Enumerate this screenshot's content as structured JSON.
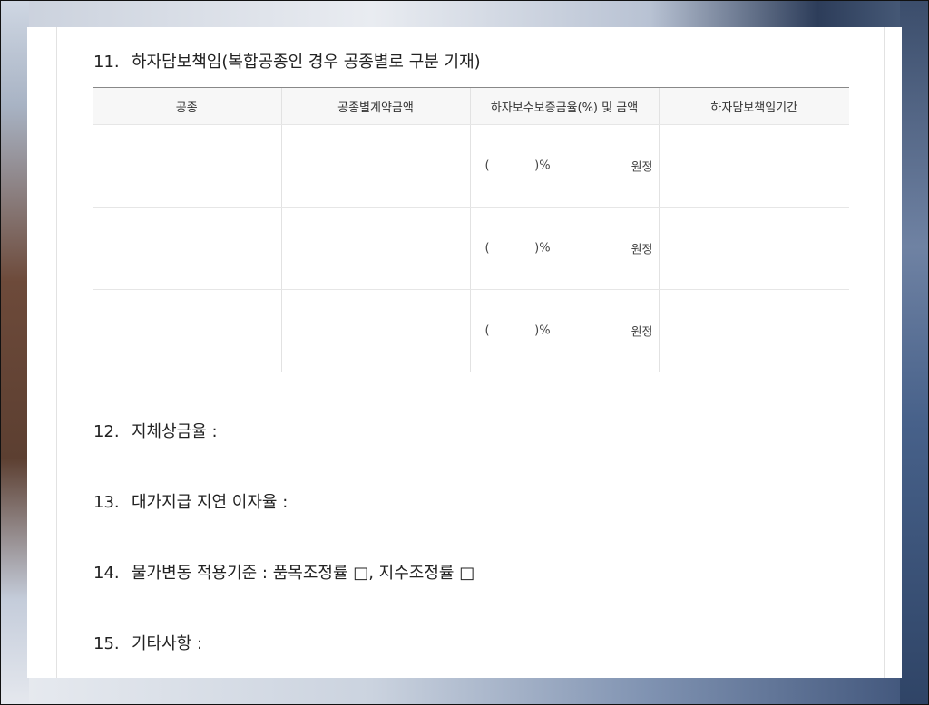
{
  "section11": {
    "number": "11.",
    "title": "하자담보책임(복합공종인 경우 공종별로 구분 기재)",
    "columns": [
      "공종",
      "공종별계약금액",
      "하자보수보증금율(%) 및 금액",
      "하자담보책임기간"
    ],
    "rows": [
      {
        "trade": "",
        "amount": "",
        "rate": "(            )%",
        "won": "원정",
        "period": ""
      },
      {
        "trade": "",
        "amount": "",
        "rate": "(            )%",
        "won": "원정",
        "period": ""
      },
      {
        "trade": "",
        "amount": "",
        "rate": "(            )%",
        "won": "원정",
        "period": ""
      }
    ]
  },
  "items": [
    {
      "number": "12.",
      "text": "지체상금율 :"
    },
    {
      "number": "13.",
      "text": "대가지급 지연 이자율 :"
    },
    {
      "number": "14.",
      "text": "물가변동 적용기준 : 품목조정률 □, 지수조정률 □"
    },
    {
      "number": "15.",
      "text": "기타사항 :"
    }
  ]
}
